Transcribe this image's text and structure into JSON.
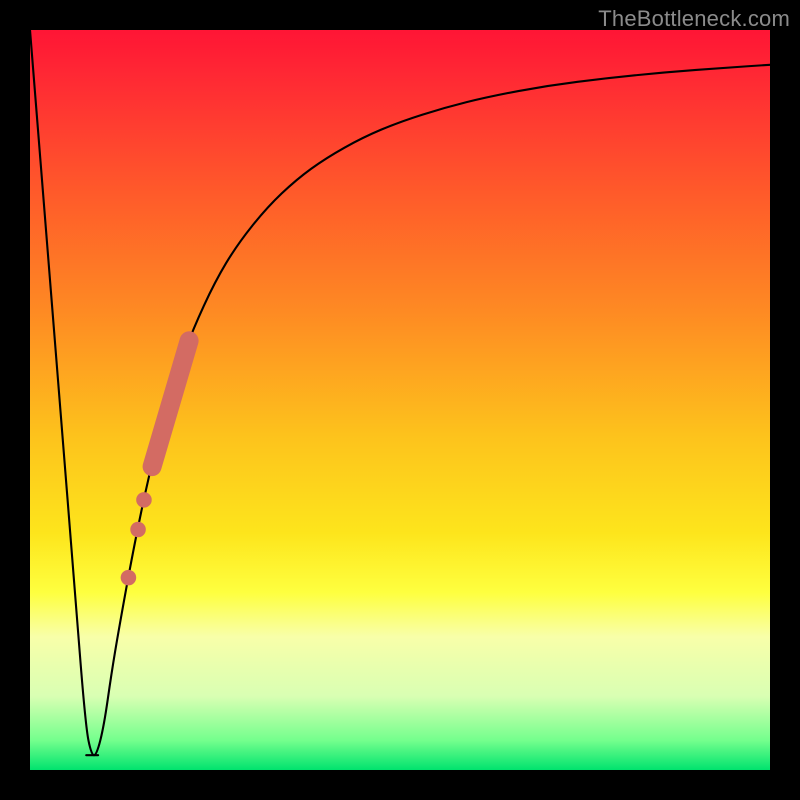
{
  "watermark": "TheBottleneck.com",
  "chart_data": {
    "type": "line",
    "title": "",
    "xlabel": "",
    "ylabel": "",
    "xlim": [
      0,
      100
    ],
    "ylim": [
      0,
      100
    ],
    "background_gradient": {
      "orientation": "vertical",
      "stops": [
        {
          "pos": 0,
          "color": "#ff1535"
        },
        {
          "pos": 8,
          "color": "#ff2e33"
        },
        {
          "pos": 22,
          "color": "#ff5a2a"
        },
        {
          "pos": 38,
          "color": "#fe8a23"
        },
        {
          "pos": 55,
          "color": "#fdc31c"
        },
        {
          "pos": 68,
          "color": "#fde51c"
        },
        {
          "pos": 76,
          "color": "#feff3f"
        },
        {
          "pos": 82,
          "color": "#f8ffa9"
        },
        {
          "pos": 90,
          "color": "#d9ffb3"
        },
        {
          "pos": 96,
          "color": "#74ff8d"
        },
        {
          "pos": 100,
          "color": "#00e36e"
        }
      ]
    },
    "series": [
      {
        "name": "bottleneck-curve",
        "color": "#000000",
        "x": [
          0,
          2,
          4,
          6,
          7.5,
          8.3,
          9,
          10,
          11,
          12,
          14,
          16,
          18,
          20,
          22,
          25,
          28,
          32,
          36,
          40,
          45,
          50,
          56,
          62,
          70,
          78,
          86,
          94,
          100
        ],
        "y": [
          100,
          75,
          50,
          25,
          6,
          2,
          2,
          6,
          13,
          19,
          30,
          39.5,
          47.5,
          54,
          59.5,
          66,
          71,
          76,
          79.8,
          82.7,
          85.5,
          87.6,
          89.5,
          91,
          92.5,
          93.5,
          94.3,
          94.9,
          95.3
        ]
      }
    ],
    "highlight_segment": {
      "name": "dense-markers",
      "color": "#d36b63",
      "from": {
        "x": 16.5,
        "y": 41
      },
      "to": {
        "x": 21.5,
        "y": 58
      }
    },
    "markers": [
      {
        "x": 13.3,
        "y": 26,
        "r": 1.0
      },
      {
        "x": 14.6,
        "y": 32.5,
        "r": 1.0
      },
      {
        "x": 15.4,
        "y": 36.5,
        "r": 1.0
      }
    ],
    "notch": {
      "x_start": 7.6,
      "x_end": 9.2,
      "y": 2
    }
  }
}
